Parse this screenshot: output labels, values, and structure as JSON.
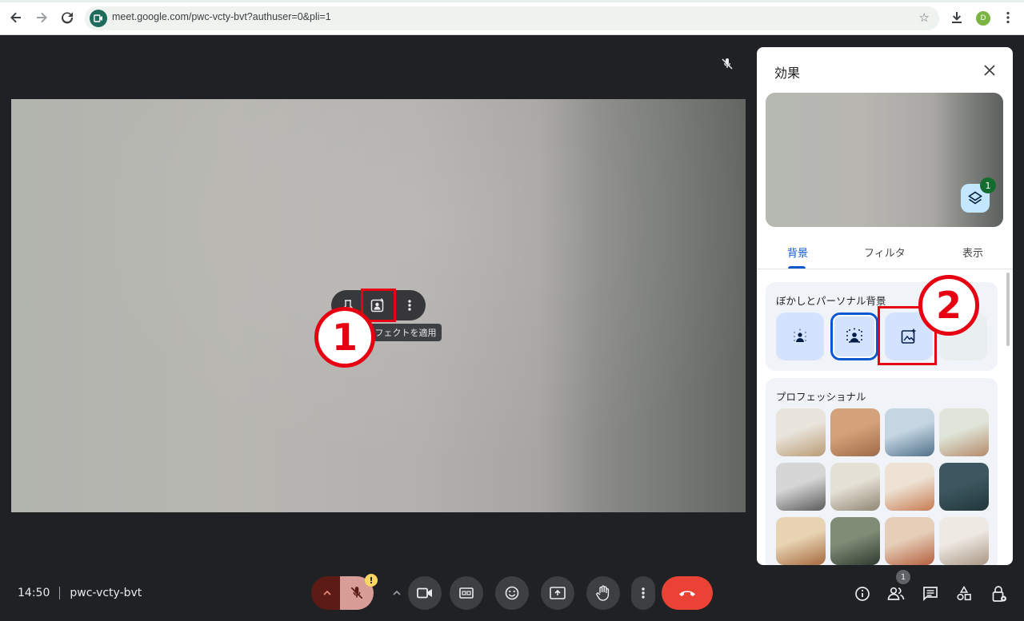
{
  "browser": {
    "url": "meet.google.com/pwc-vcty-bvt?authuser=0&pli=1",
    "profile_initial": "D"
  },
  "tile_menu": {
    "tooltip": "フェクトを適用"
  },
  "annotations": {
    "step1": "1",
    "step2": "2"
  },
  "meeting": {
    "time": "14:50",
    "code": "pwc-vcty-bvt",
    "mic_warning": "!",
    "people_count": "1"
  },
  "effects_panel": {
    "title": "効果",
    "layers_count": "1",
    "tabs": [
      "背景",
      "フィルタ",
      "表示"
    ],
    "active_tab": "背景",
    "section_blur_title": "ぼかしとパーソナル背景",
    "section_pro_title": "プロフェッショナル"
  },
  "colors": {
    "accent": "#0b57d0",
    "annotation_red": "#e60012",
    "end_call": "#ea4335",
    "panel_bg": "#ffffff",
    "stage_bg": "#202124"
  },
  "background_thumbs": [
    {
      "name": "bookshelf-room",
      "c1": "#e9e4dc",
      "c2": "#b99b74"
    },
    {
      "name": "wood-wall-plant",
      "c1": "#d4a27a",
      "c2": "#9c6a46"
    },
    {
      "name": "glass-office",
      "c1": "#c5d6e2",
      "c2": "#4f7089"
    },
    {
      "name": "green-lounge",
      "c1": "#dfe6d9",
      "c2": "#b48a6b"
    },
    {
      "name": "library-chair",
      "c1": "#d6d6d6",
      "c2": "#5a5a5a"
    },
    {
      "name": "lamp-room",
      "c1": "#e6e1d6",
      "c2": "#8f8673"
    },
    {
      "name": "desk-plants",
      "c1": "#ede2d3",
      "c2": "#c77b52"
    },
    {
      "name": "night-window",
      "c1": "#3d5760",
      "c2": "#22363b"
    },
    {
      "name": "living-room",
      "c1": "#e8d3b3",
      "c2": "#a56a3e"
    },
    {
      "name": "garden-patio",
      "c1": "#7f8d77",
      "c2": "#2f3b2f"
    },
    {
      "name": "brick-cafe",
      "c1": "#e6cfb9",
      "c2": "#b4603f"
    },
    {
      "name": "white-lamp",
      "c1": "#efe9e3",
      "c2": "#a89684"
    }
  ]
}
